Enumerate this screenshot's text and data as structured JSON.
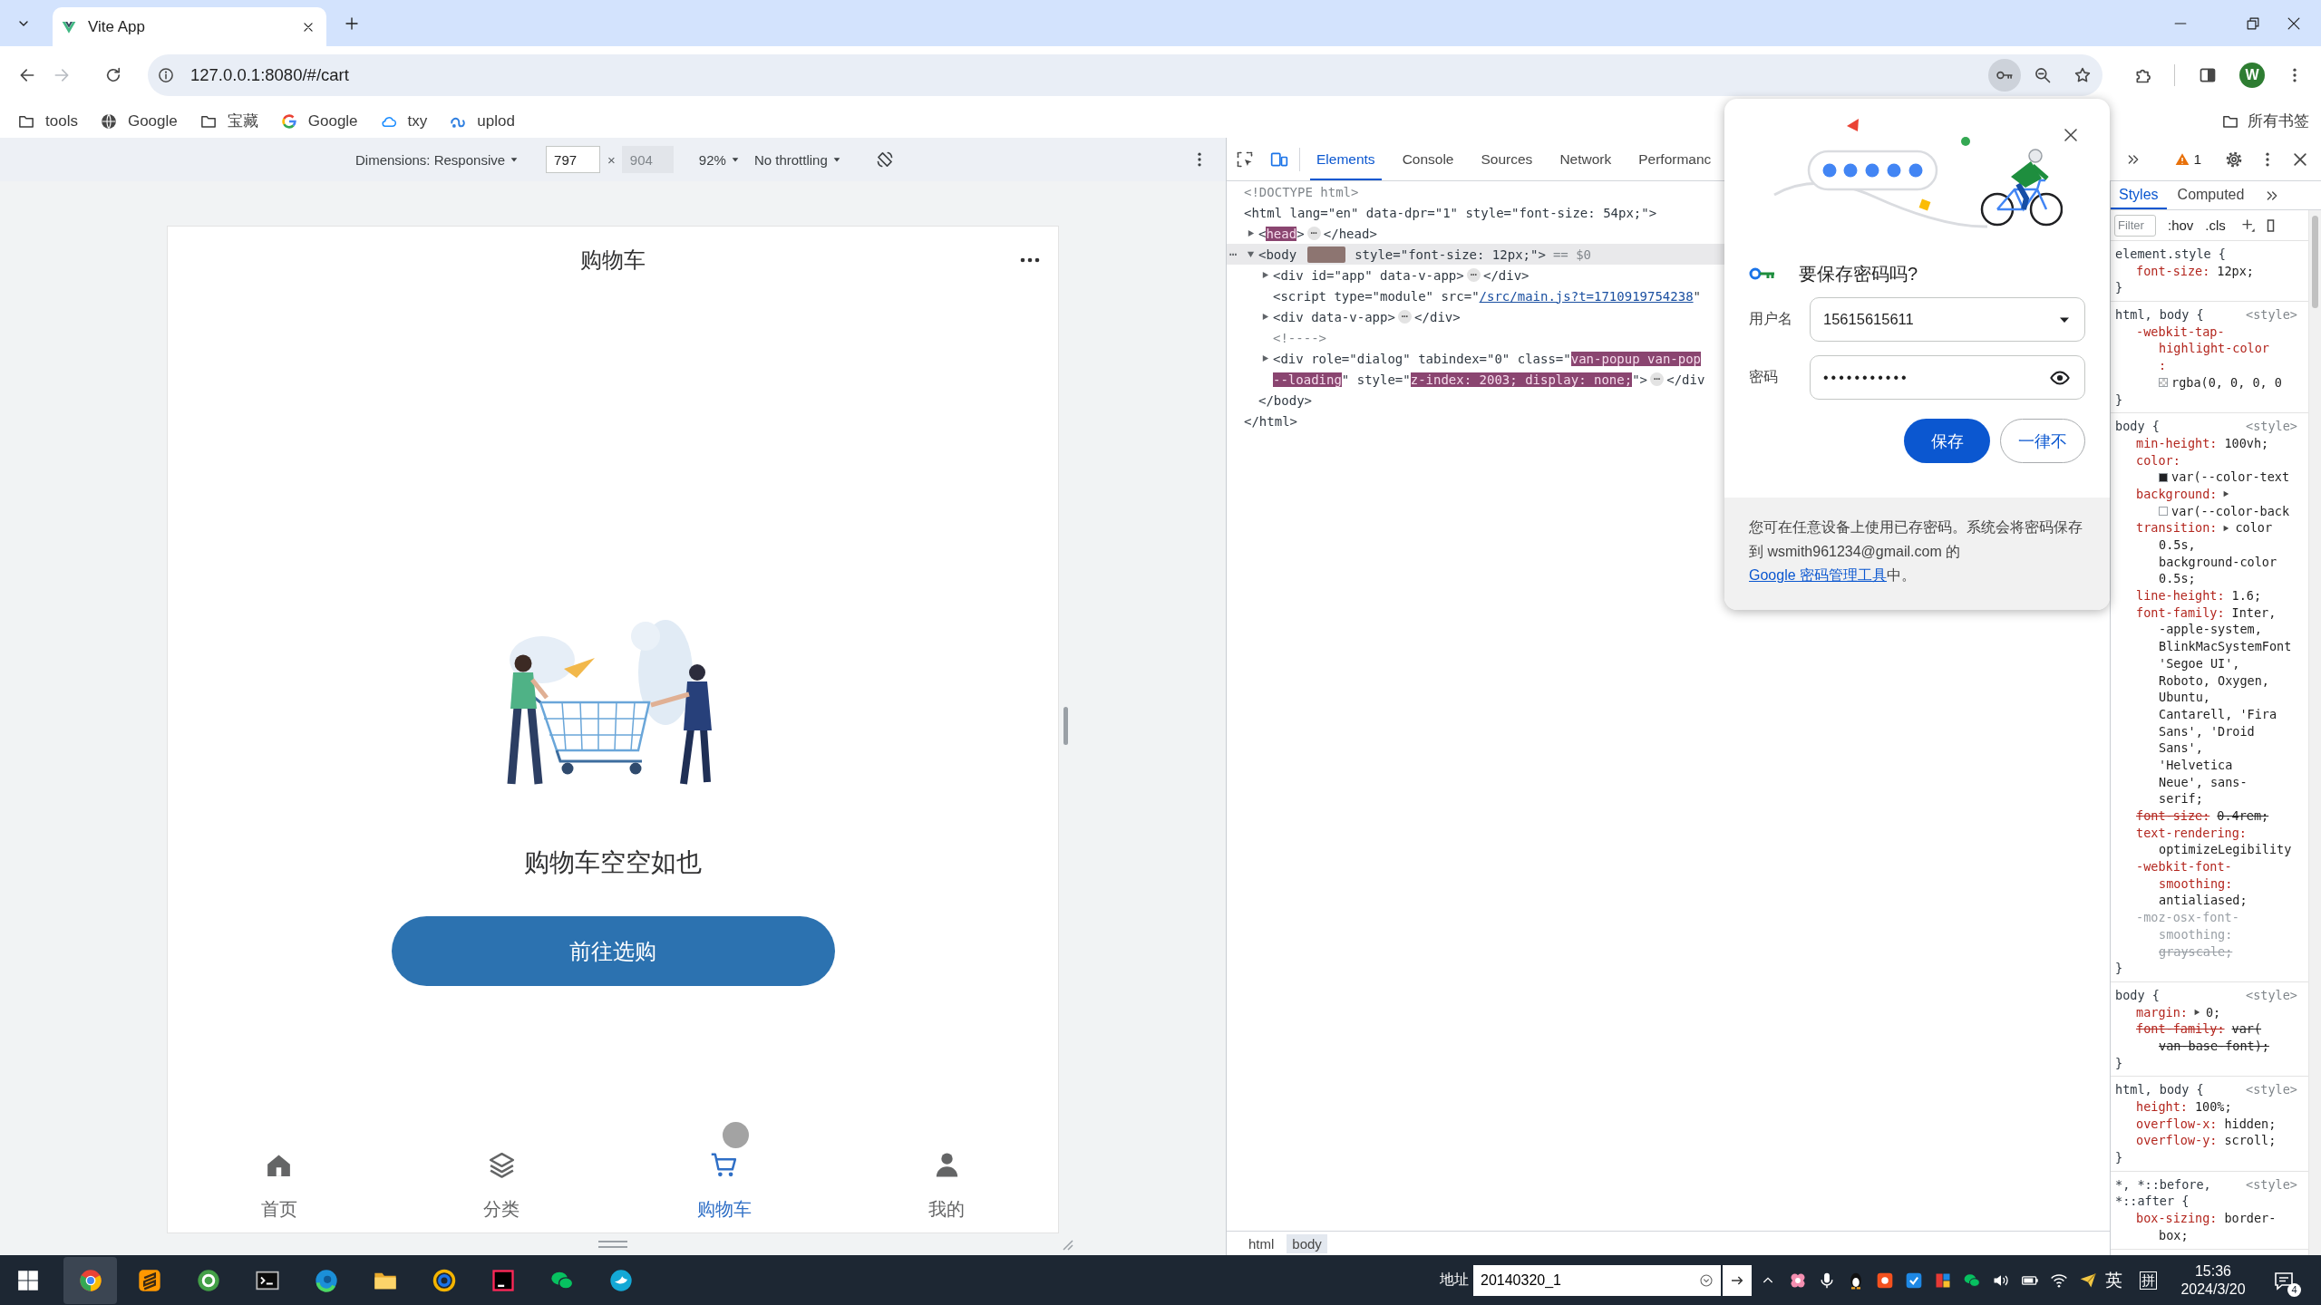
{
  "tab_strip": {
    "tabs": [
      {
        "title": "Vite App",
        "selected": true
      }
    ]
  },
  "toolbar": {
    "url": "127.0.0.1:8080/#/cart",
    "password_key_active": true,
    "profile_initial": "W"
  },
  "bookmarks_bar": {
    "items": [
      {
        "label": "tools",
        "kind": "folder"
      },
      {
        "label": "Google",
        "kind": "globe"
      },
      {
        "label": "宝藏",
        "kind": "folder"
      },
      {
        "label": "Google",
        "kind": "google"
      },
      {
        "label": "txy",
        "kind": "cloud"
      },
      {
        "label": "uplod",
        "kind": "swirl"
      }
    ],
    "all_bookmarks": "所有书签"
  },
  "device_toolbar": {
    "dimensions": "Dimensions: Responsive",
    "width": {
      "value": "797",
      "dimmed": false
    },
    "times": "×",
    "height": {
      "value": "904",
      "dimmed": true
    },
    "zoom": "92%",
    "throttling": "No throttling"
  },
  "phone": {
    "title": "购物车",
    "empty_text": "购物车空空如也",
    "button": "前往选购",
    "tabbar": [
      {
        "label": "首页",
        "kind": "home",
        "selected": false
      },
      {
        "label": "分类",
        "kind": "layers",
        "selected": false
      },
      {
        "label": "购物车",
        "kind": "cart",
        "selected": true
      },
      {
        "label": "我的",
        "kind": "user",
        "selected": false
      }
    ]
  },
  "devtools": {
    "tabs": [
      {
        "label": "Elements",
        "selected": true
      },
      {
        "label": "Console",
        "selected": false
      },
      {
        "label": "Sources",
        "selected": false
      },
      {
        "label": "Network",
        "selected": false
      },
      {
        "label": "Performanc",
        "selected": false
      }
    ],
    "issues_count": "1",
    "dom_tree": [
      {
        "selected": false,
        "items": [
          {
            "kind": "code",
            "segments": [
              {
                "text": "<!DOCTYPE html>",
                "kind": "dim"
              }
            ]
          }
        ]
      },
      {
        "selected": false,
        "items": [
          {
            "kind": "code",
            "segments": [
              {
                "text": "<html lang=\"en\" data-dpr=\"1\" style=\"font-size: 54px;\">",
                "kind": "plain"
              }
            ]
          }
        ],
        "children": [
          {
            "expanded": false,
            "selected": false,
            "items": [
              {
                "kind": "code",
                "segments": [
                  {
                    "text": "<",
                    "kind": "plain"
                  },
                  {
                    "text": "head",
                    "kind": "mark"
                  },
                  {
                    "text": ">",
                    "kind": "plain"
                  }
                ]
              },
              {
                "kind": "more",
                "text": "⋯"
              },
              {
                "kind": "code",
                "segments": [
                  {
                    "text": "</head>",
                    "kind": "plain"
                  }
                ]
              }
            ]
          },
          {
            "expanded": true,
            "selected": true,
            "gutter": "⋯",
            "items": [
              {
                "kind": "code",
                "segments": [
                  {
                    "text": "<body",
                    "kind": "plain"
                  }
                ]
              },
              {
                "kind": "smudge"
              },
              {
                "kind": "code",
                "segments": [
                  {
                    "text": "style=\"font-size: 12px;\">",
                    "kind": "plain"
                  }
                ]
              },
              {
                "kind": "code",
                "segments": [
                  {
                    "text": "== $0",
                    "kind": "dim"
                  }
                ]
              }
            ],
            "children": [
              {
                "expanded": false,
                "selected": false,
                "items": [
                  {
                    "kind": "code",
                    "segments": [
                      {
                        "text": "<div id=\"app\" data-v-app>",
                        "kind": "plain"
                      }
                    ]
                  },
                  {
                    "kind": "more",
                    "text": "⋯"
                  },
                  {
                    "kind": "code",
                    "segments": [
                      {
                        "text": "</div>",
                        "kind": "plain"
                      }
                    ]
                  }
                ]
              },
              {
                "selected": false,
                "items": [
                  {
                    "kind": "code",
                    "segments": [
                      {
                        "text": "<script type=\"module\" src=\"",
                        "kind": "plain"
                      },
                      {
                        "text": "/src/main.js?t=1710919754238",
                        "kind": "link"
                      },
                      {
                        "text": "\"",
                        "kind": "plain"
                      }
                    ]
                  }
                ]
              },
              {
                "expanded": false,
                "selected": false,
                "items": [
                  {
                    "kind": "code",
                    "segments": [
                      {
                        "text": "<div data-v-app>",
                        "kind": "plain"
                      }
                    ]
                  },
                  {
                    "kind": "more",
                    "text": "⋯"
                  },
                  {
                    "kind": "code",
                    "segments": [
                      {
                        "text": "</div>",
                        "kind": "plain"
                      }
                    ]
                  }
                ]
              },
              {
                "selected": false,
                "items": [
                  {
                    "kind": "code",
                    "segments": [
                      {
                        "text": "<!---->",
                        "kind": "dim"
                      }
                    ]
                  }
                ]
              },
              {
                "expanded": false,
                "selected": false,
                "items": [
                  {
                    "kind": "code",
                    "segments": [
                      {
                        "text": "<div role=\"dialog\" tabindex=\"0\" class=\"",
                        "kind": "plain"
                      },
                      {
                        "text": "van-popup van-pop",
                        "kind": "mark"
                      }
                    ]
                  }
                ],
                "wrapped_items": [
                  {
                    "kind": "code",
                    "segments": [
                      {
                        "text": "--loading",
                        "kind": "mark"
                      },
                      {
                        "text": "\" style=\"",
                        "kind": "plain"
                      },
                      {
                        "text": "z-index: 2003; display: none;",
                        "kind": "mark"
                      },
                      {
                        "text": "\">",
                        "kind": "plain"
                      }
                    ]
                  },
                  {
                    "kind": "more",
                    "text": "⋯"
                  },
                  {
                    "kind": "code",
                    "segments": [
                      {
                        "text": "</div",
                        "kind": "plain"
                      }
                    ]
                  }
                ]
              }
            ],
            "closing": [
              {
                "kind": "code",
                "segments": [
                  {
                    "text": "</body>",
                    "kind": "plain"
                  }
                ]
              }
            ]
          }
        ],
        "closing": [
          {
            "kind": "code",
            "segments": [
              {
                "text": "</html>",
                "kind": "plain"
              }
            ]
          }
        ]
      }
    ],
    "breadcrumbs": [
      {
        "label": "html",
        "selected": false
      },
      {
        "label": "body",
        "selected": true
      }
    ],
    "styles_tabs": [
      {
        "label": "Styles",
        "selected": true
      },
      {
        "label": "Computed",
        "selected": false
      }
    ],
    "filter_placeholder": "Filter",
    "hov": ":hov",
    "cls": ".cls",
    "rules": [
      {
        "selector_lines": [
          "element.style {"
        ],
        "declarations": [
          {
            "property_lines": [
              "font-size:"
            ],
            "value_lines": [
              "12px;"
            ],
            "value_on_new_line": false,
            "overridden": false,
            "inactive": false
          }
        ],
        "closing": "}"
      },
      {
        "selector_lines": [
          "html, body {"
        ],
        "source": "<style>",
        "declarations": [
          {
            "property_lines": [
              "-webkit-tap-",
              "highlight-color",
              ":"
            ],
            "value_lines": [
              "rgba(0, 0, 0, 0"
            ],
            "value_on_new_line": true,
            "swatch": {
              "kind": "checker"
            },
            "overridden": false,
            "inactive": false
          }
        ],
        "closing": "}"
      },
      {
        "selector_lines": [
          "body {"
        ],
        "source": "<style>",
        "declarations": [
          {
            "property_lines": [
              "min-height:"
            ],
            "value_lines": [
              "100vh;"
            ],
            "value_on_new_line": false,
            "overridden": false,
            "inactive": false
          },
          {
            "property_lines": [
              "color:"
            ],
            "value_lines": [
              "var(--color-text"
            ],
            "value_on_new_line": true,
            "swatch": {
              "kind": "solid",
              "color": "#202124"
            },
            "overridden": false,
            "inactive": false
          },
          {
            "property_lines": [
              "background:"
            ],
            "value_lines": [
              "var(--color-back"
            ],
            "expandable": true,
            "value_on_new_line": true,
            "swatch": {
              "kind": "solid",
              "color": "#ffffff"
            },
            "overridden": false,
            "inactive": false
          },
          {
            "property_lines": [
              "transition:"
            ],
            "value_lines": [
              "color",
              "0.5s,",
              "background-color",
              "0.5s;"
            ],
            "expandable": true,
            "value_on_new_line": false,
            "overridden": false,
            "inactive": false
          },
          {
            "property_lines": [
              "line-height:"
            ],
            "value_lines": [
              "1.6;"
            ],
            "value_on_new_line": false,
            "overridden": false,
            "inactive": false
          },
          {
            "property_lines": [
              "font-family:"
            ],
            "value_lines": [
              "Inter,",
              "-apple-system,",
              "BlinkMacSystemFont",
              "'Segoe UI',",
              "Roboto, Oxygen,",
              "Ubuntu,",
              "Cantarell, 'Fira",
              "Sans', 'Droid",
              "Sans',",
              "'Helvetica",
              "Neue', sans-",
              "serif;"
            ],
            "value_on_new_line": false,
            "overridden": false,
            "inactive": false
          },
          {
            "property_lines": [
              "font-size:"
            ],
            "value_lines": [
              "0.4rem;"
            ],
            "value_on_new_line": false,
            "overridden": true,
            "inactive": false
          },
          {
            "property_lines": [
              "text-rendering:"
            ],
            "value_lines": [
              "optimizeLegibility"
            ],
            "value_on_new_line": true,
            "overridden": false,
            "inactive": false
          },
          {
            "property_lines": [
              "-webkit-font-",
              "smoothing:"
            ],
            "value_lines": [
              "antialiased;"
            ],
            "value_on_new_line": true,
            "overridden": false,
            "inactive": false
          },
          {
            "property_lines": [
              "-moz-osx-font-",
              "smoothing:"
            ],
            "value_lines": [
              "grayscale;"
            ],
            "value_on_new_line": true,
            "overridden": false,
            "inactive": true
          }
        ],
        "closing": "}"
      },
      {
        "selector_lines": [
          "body {"
        ],
        "source": "<style>",
        "declarations": [
          {
            "property_lines": [
              "margin:"
            ],
            "value_lines": [
              "0;"
            ],
            "expandable": true,
            "value_on_new_line": false,
            "overridden": false,
            "inactive": false
          },
          {
            "property_lines": [
              "font-family:"
            ],
            "value_lines": [
              "var(",
              "van-base-font);"
            ],
            "value_on_new_line": false,
            "overridden": true,
            "inactive": false
          }
        ],
        "closing": "}"
      },
      {
        "selector_lines": [
          "html, body {"
        ],
        "source": "<style>",
        "declarations": [
          {
            "property_lines": [
              "height:"
            ],
            "value_lines": [
              "100%;"
            ],
            "value_on_new_line": false,
            "overridden": false,
            "inactive": false
          },
          {
            "property_lines": [
              "overflow-x:"
            ],
            "value_lines": [
              "hidden;"
            ],
            "value_on_new_line": false,
            "overridden": false,
            "inactive": false
          },
          {
            "property_lines": [
              "overflow-y:"
            ],
            "value_lines": [
              "scroll;"
            ],
            "value_on_new_line": false,
            "overridden": false,
            "inactive": false
          }
        ],
        "closing": "}"
      },
      {
        "selector_lines": [
          "*, *::before,",
          "*::after {"
        ],
        "source": "<style>",
        "declarations": [
          {
            "property_lines": [
              "box-sizing:"
            ],
            "value_lines": [
              "border-",
              "box;"
            ],
            "value_on_new_line": false,
            "overridden": false,
            "inactive": false
          }
        ]
      }
    ]
  },
  "password_popup": {
    "title": "要保存密码吗?",
    "username_label": "用户名",
    "username": "15615615611",
    "password_label": "密码",
    "password": "•••••••••••",
    "save_button": "保存",
    "never_button": "一律不",
    "note_before": "您可在任意设备上使用已存密码。系统会将密码保存到 wsmith961234@gmail.com 的",
    "note_link": "Google 密码管理工具",
    "note_after": "中。"
  },
  "taskbar": {
    "apps": [
      {
        "kind": "browser",
        "selected": true
      },
      {
        "kind": "editor",
        "selected": false
      },
      {
        "kind": "green-browser",
        "selected": false
      },
      {
        "kind": "terminal",
        "selected": false
      },
      {
        "kind": "edge",
        "selected": false
      },
      {
        "kind": "files",
        "selected": false
      },
      {
        "kind": "ring",
        "selected": false
      },
      {
        "kind": "ide",
        "selected": false
      },
      {
        "kind": "chat",
        "selected": false
      },
      {
        "kind": "bird",
        "selected": false
      }
    ],
    "address_label": "地址",
    "address_value": "20140320_1",
    "ime": "英",
    "ime_mode": "拼",
    "time": "15:36",
    "date": "2024/3/20",
    "notifications": "4"
  }
}
